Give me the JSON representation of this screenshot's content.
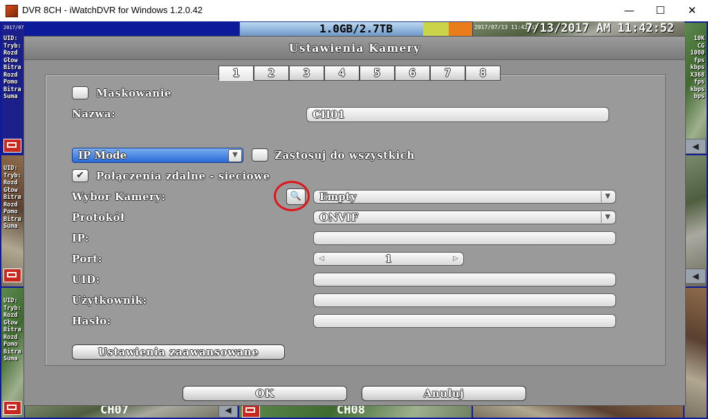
{
  "window": {
    "title": "DVR 8CH - iWatchDVR for Windows 1.2.0.42",
    "minimize": "—",
    "maximize": "☐",
    "close": "✕"
  },
  "dvr": {
    "storage": "1.0GB/2.7TB",
    "clock": "7/13/2017 AM 11:42:52",
    "tile_timestamp": "2017/07/13 11:42:53",
    "tile_timestamp2": "2017/07/13 11:42:53",
    "osd_left": [
      "UID:",
      "Tryb:",
      "Rozd",
      "Głow",
      "Bitra",
      "Rozd",
      "Pomo",
      "Bitra",
      "Suma"
    ],
    "osd_right": [
      "10K",
      "CG",
      "1080",
      "fps",
      "kbps",
      "X368",
      "fps",
      "kbps",
      "bps"
    ],
    "ch07": "CH07",
    "ch08": "CH08"
  },
  "dialog": {
    "title": "Ustawienia Kamery",
    "tabs": [
      "1",
      "2",
      "3",
      "4",
      "5",
      "6",
      "7",
      "8"
    ],
    "masking_label": "Maskowanie",
    "name_label": "Nazwa:",
    "name_value": "CH01",
    "mode_value": "IP Mode",
    "apply_all_label": "Zastosuj do wszystkich",
    "remote_label": "Połączenia zdalne - sieciowe",
    "remote_check": "✔",
    "camera_select_label": "Wybor Kamery:",
    "camera_select_value": "Empty",
    "protocol_label": "Protokół",
    "protocol_value": "ONVIF",
    "ip_label": "IP:",
    "port_label": "Port:",
    "port_value": "1",
    "uid_label": "UID:",
    "user_label": "Użytkownik:",
    "password_label": "Hasło:",
    "advanced_button": "Ustawienia zaawansowane",
    "ok_button": "OK",
    "cancel_button": "Anuluj"
  },
  "icons": {
    "search": "🔍",
    "dropdown": "▼",
    "spin_left": "◁",
    "spin_right": "▷",
    "speaker": "◀"
  }
}
